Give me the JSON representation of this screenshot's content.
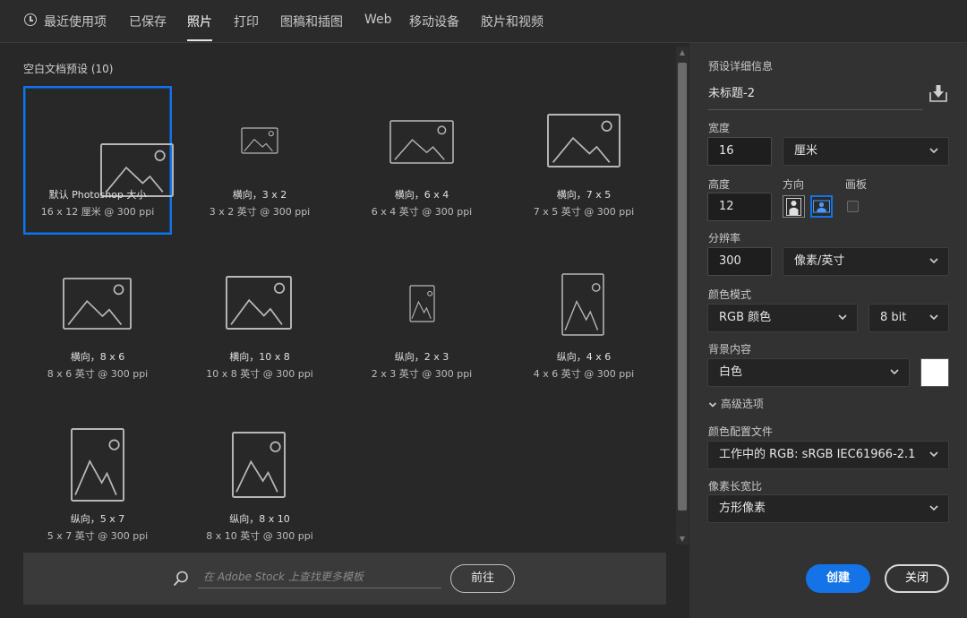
{
  "tabs": [
    {
      "label": "最近使用项",
      "active": false
    },
    {
      "label": "已保存",
      "active": false
    },
    {
      "label": "照片",
      "active": true
    },
    {
      "label": "打印",
      "active": false
    },
    {
      "label": "图稿和插图",
      "active": false
    },
    {
      "label": "Web",
      "active": false
    },
    {
      "label": "移动设备",
      "active": false
    },
    {
      "label": "胶片和视频",
      "active": false
    }
  ],
  "presets": {
    "title": "空白文档预设 (10)",
    "items": [
      {
        "name": "默认 Photoshop 大小",
        "size": "16 x 12 厘米 @ 300 ppi",
        "orientation": "landscape",
        "selected": true
      },
      {
        "name": "横向，3 x 2",
        "size": "3 x 2 英寸 @ 300 ppi",
        "orientation": "landscape",
        "selected": false
      },
      {
        "name": "横向，6 x 4",
        "size": "6 x 4 英寸 @ 300 ppi",
        "orientation": "landscape",
        "selected": false
      },
      {
        "name": "横向，7 x 5",
        "size": "7 x 5 英寸 @ 300 ppi",
        "orientation": "landscape",
        "selected": false
      },
      {
        "name": "横向，8 x 6",
        "size": "8 x 6 英寸 @ 300 ppi",
        "orientation": "landscape",
        "selected": false
      },
      {
        "name": "横向，10 x 8",
        "size": "10 x 8 英寸 @ 300 ppi",
        "orientation": "landscape",
        "selected": false
      },
      {
        "name": "纵向，2 x 3",
        "size": "2 x 3 英寸 @ 300 ppi",
        "orientation": "portrait",
        "selected": false
      },
      {
        "name": "纵向，4 x 6",
        "size": "4 x 6 英寸 @ 300 ppi",
        "orientation": "portrait",
        "selected": false
      },
      {
        "name": "纵向，5 x 7",
        "size": "5 x 7 英寸 @ 300 ppi",
        "orientation": "portrait",
        "selected": false
      },
      {
        "name": "纵向，8 x 10",
        "size": "8 x 10 英寸 @ 300 ppi",
        "orientation": "portrait",
        "selected": false
      }
    ]
  },
  "stock": {
    "placeholder": "在 Adobe Stock 上查找更多模板",
    "go_label": "前往"
  },
  "details": {
    "section_title": "预设详细信息",
    "doc_name": "未标题-2",
    "width_label": "宽度",
    "width_value": "16",
    "width_unit": "厘米",
    "height_label": "高度",
    "height_value": "12",
    "orientation_label": "方向",
    "artboard_label": "画板",
    "resolution_label": "分辨率",
    "resolution_value": "300",
    "resolution_unit": "像素/英寸",
    "color_mode_label": "颜色模式",
    "color_mode": "RGB 颜色",
    "bit_depth": "8 bit",
    "background_label": "背景内容",
    "background": "白色",
    "background_color": "#ffffff",
    "advanced_label": "高级选项",
    "color_profile_label": "颜色配置文件",
    "color_profile": "工作中的 RGB: sRGB IEC61966-2.1",
    "pixel_aspect_label": "像素长宽比",
    "pixel_aspect": "方形像素",
    "create_label": "创建",
    "close_label": "关闭"
  },
  "colors": {
    "accent": "#1473e6"
  }
}
